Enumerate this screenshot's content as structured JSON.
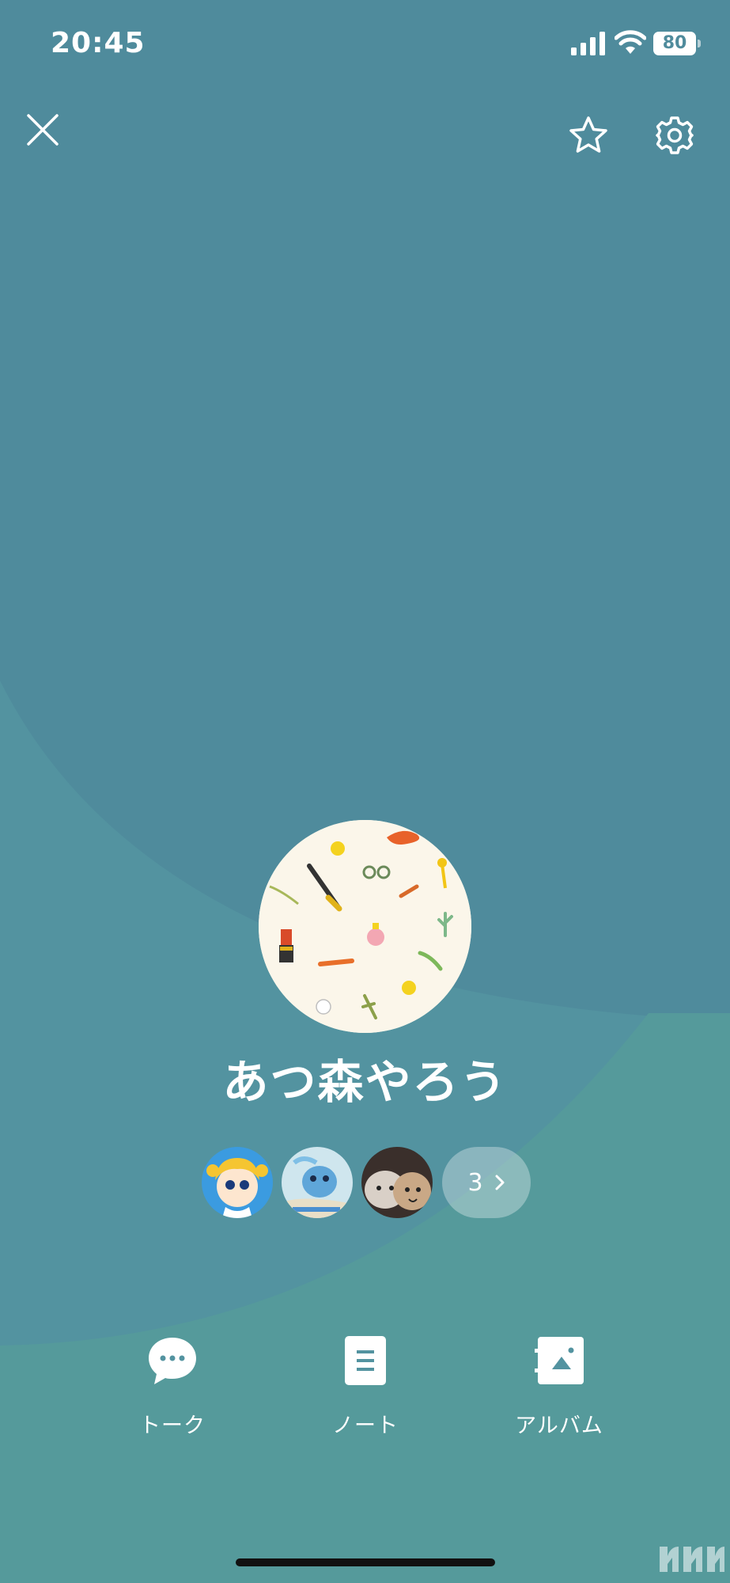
{
  "status_bar": {
    "time": "20:45",
    "battery_level": "80"
  },
  "header": {
    "close_icon": "close-icon",
    "favorite_icon": "star-outline-icon",
    "settings_icon": "gear-icon"
  },
  "profile": {
    "name": "あつ森やろう",
    "avatar_icon": "pattern-avatar"
  },
  "friends": {
    "more_count": "3"
  },
  "actions": [
    {
      "label": "トーク",
      "icon": "chat-bubble-icon"
    },
    {
      "label": "ノート",
      "icon": "note-icon"
    },
    {
      "label": "アルバム",
      "icon": "album-icon"
    }
  ],
  "colors": {
    "background": "#4f8b9c",
    "accent": "#ffffff"
  }
}
